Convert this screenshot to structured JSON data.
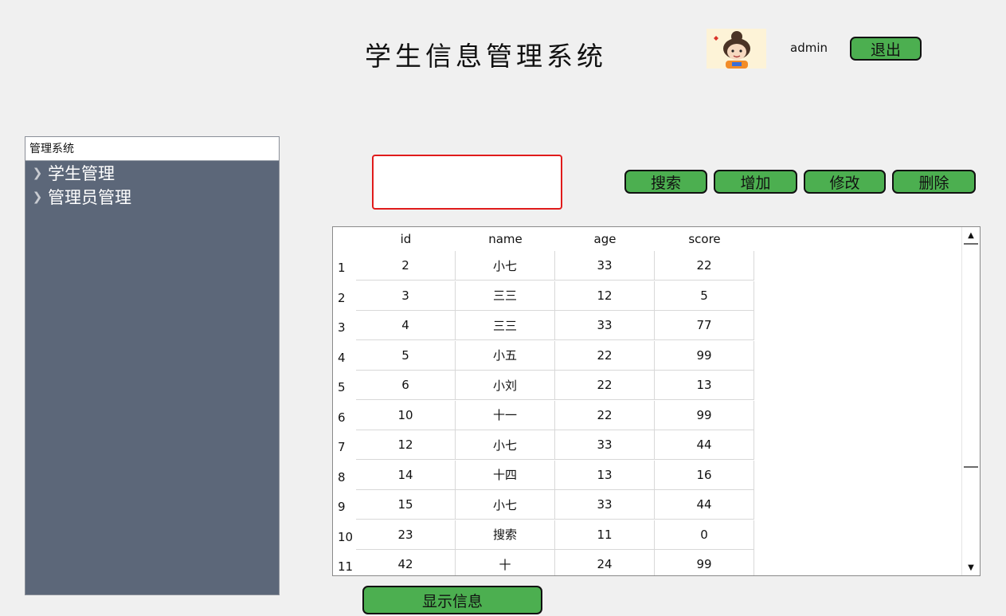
{
  "header": {
    "title": "学生信息管理系统",
    "username": "admin",
    "logout_label": "退出",
    "avatar_icon": "cartoon-girl-avatar"
  },
  "sidebar": {
    "header": "管理系统",
    "items": [
      {
        "label": "学生管理",
        "icon": "chevron-right-icon"
      },
      {
        "label": "管理员管理",
        "icon": "chevron-right-icon"
      }
    ]
  },
  "toolbar": {
    "search_value": "",
    "search_placeholder": "",
    "search_label": "搜索",
    "add_label": "增加",
    "edit_label": "修改",
    "delete_label": "删除"
  },
  "table": {
    "columns": [
      "id",
      "name",
      "age",
      "score"
    ],
    "rows": [
      {
        "num": "1",
        "cells": [
          "2",
          "小七",
          "33",
          "22"
        ]
      },
      {
        "num": "2",
        "cells": [
          "3",
          "三三",
          "12",
          "5"
        ]
      },
      {
        "num": "3",
        "cells": [
          "4",
          "三三",
          "33",
          "77"
        ]
      },
      {
        "num": "4",
        "cells": [
          "5",
          "小五",
          "22",
          "99"
        ]
      },
      {
        "num": "5",
        "cells": [
          "6",
          "小刘",
          "22",
          "13"
        ]
      },
      {
        "num": "6",
        "cells": [
          "10",
          "十一",
          "22",
          "99"
        ]
      },
      {
        "num": "7",
        "cells": [
          "12",
          "小七",
          "33",
          "44"
        ]
      },
      {
        "num": "8",
        "cells": [
          "14",
          "十四",
          "13",
          "16"
        ]
      },
      {
        "num": "9",
        "cells": [
          "15",
          "小七",
          "33",
          "44"
        ]
      },
      {
        "num": "10",
        "cells": [
          "23",
          "搜索",
          "11",
          "0"
        ]
      },
      {
        "num": "11",
        "cells": [
          "42",
          "十",
          "24",
          "99"
        ]
      }
    ]
  },
  "footer": {
    "show_label": "显示信息"
  },
  "colors": {
    "button": "#4caf50",
    "sidebar": "#5c6779",
    "search_border": "#e01b1b",
    "background": "#f0f0f0"
  }
}
